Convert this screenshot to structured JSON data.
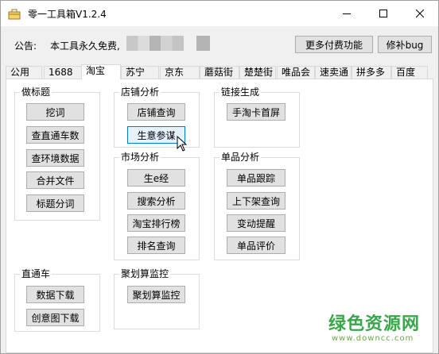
{
  "window": {
    "title": "零一工具箱V1.2.4"
  },
  "notice": {
    "label": "公告:",
    "text": "本工具永久免费,"
  },
  "header_buttons": {
    "more_paid": "更多付费功能",
    "fix_bug": "修补bug"
  },
  "tabs": [
    "公用",
    "1688",
    "淘宝",
    "苏宁",
    "京东",
    "蘑菇街",
    "楚楚街",
    "唯品会",
    "速卖通",
    "拼多多",
    "百度"
  ],
  "active_tab": "淘宝",
  "groups": {
    "title_gen": {
      "title": "做标题",
      "buttons": [
        "挖词",
        "查直通车数",
        "查环境数据",
        "合并文件",
        "标题分词"
      ]
    },
    "shop_analysis": {
      "title": "店铺分析",
      "buttons": [
        "店铺查询",
        "生意参谋"
      ]
    },
    "link_gen": {
      "title": "链接生成",
      "buttons": [
        "手淘卡首屏"
      ]
    },
    "market_analysis": {
      "title": "市场分析",
      "buttons": [
        "生e经",
        "搜索分析",
        "淘宝排行榜",
        "排名查询"
      ]
    },
    "item_analysis": {
      "title": "单品分析",
      "buttons": [
        "单品跟踪",
        "上下架查询",
        "变动提醒",
        "单品评价"
      ]
    },
    "ztc": {
      "title": "直通车",
      "buttons": [
        "数据下载",
        "创意图下载"
      ]
    },
    "jhs": {
      "title": "聚划算监控",
      "buttons": [
        "聚划算监控"
      ]
    }
  },
  "watermark": {
    "cn": "绿色资源网",
    "url": "www.downcc.com"
  },
  "colors": {
    "button_face": "#e1e1e1",
    "focus_border": "#0078d7",
    "watermark_green": "#3aa64a"
  }
}
